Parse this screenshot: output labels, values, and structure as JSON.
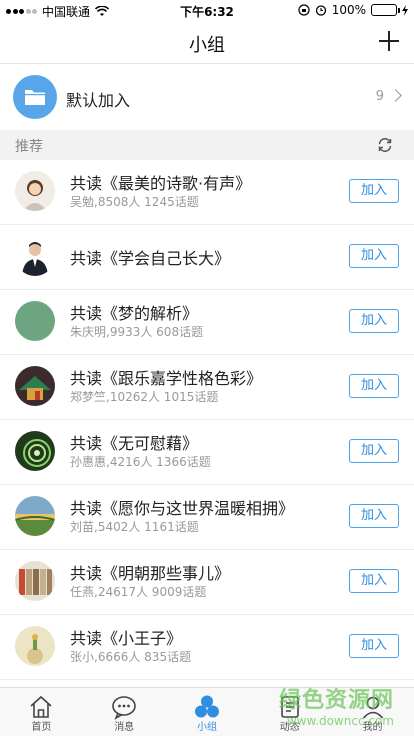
{
  "status_bar": {
    "carrier": "中国联通",
    "time": "下午6:32",
    "battery": "100%"
  },
  "nav": {
    "title": "小组",
    "add_icon": "plus-icon"
  },
  "default_group": {
    "label": "默认加入",
    "count": "9",
    "icon": "folder-icon"
  },
  "section": {
    "label": "推荐",
    "icon": "refresh-icon"
  },
  "groups": [
    {
      "title": "共读《最美的诗歌·有声》",
      "meta": "吴勉,8508人 1245话题",
      "join": "加入"
    },
    {
      "title": "共读《学会自己长大》",
      "meta": "",
      "join": "加入"
    },
    {
      "title": "共读《梦的解析》",
      "meta": "朱庆明,9933人 608话题",
      "join": "加入"
    },
    {
      "title": "共读《跟乐嘉学性格色彩》",
      "meta": "郑梦竺,10262人 1015话题",
      "join": "加入"
    },
    {
      "title": "共读《无可慰藉》",
      "meta": "孙惠惠,4216人 1366话题",
      "join": "加入"
    },
    {
      "title": "共读《愿你与这世界温暖相拥》",
      "meta": "刘苗,5402人 1161话题",
      "join": "加入"
    },
    {
      "title": "共读《明朝那些事儿》",
      "meta": "任燕,24617人 9009话题",
      "join": "加入"
    },
    {
      "title": "共读《小王子》",
      "meta": "张小,6666人 835话题",
      "join": "加入"
    }
  ],
  "tabs": [
    {
      "label": "首页",
      "icon": "home-icon"
    },
    {
      "label": "消息",
      "icon": "message-icon"
    },
    {
      "label": "小组",
      "icon": "group-icon",
      "active": true
    },
    {
      "label": "动态",
      "icon": "feed-icon"
    },
    {
      "label": "我的",
      "icon": "profile-icon"
    }
  ],
  "watermark": {
    "title": "绿色资源网",
    "url": "www.downcc.com"
  },
  "colors": {
    "accent": "#2f8ee0",
    "folder": "#59a5ea",
    "section_bg": "#f2f2f2",
    "watermark": "#6bc35a"
  }
}
